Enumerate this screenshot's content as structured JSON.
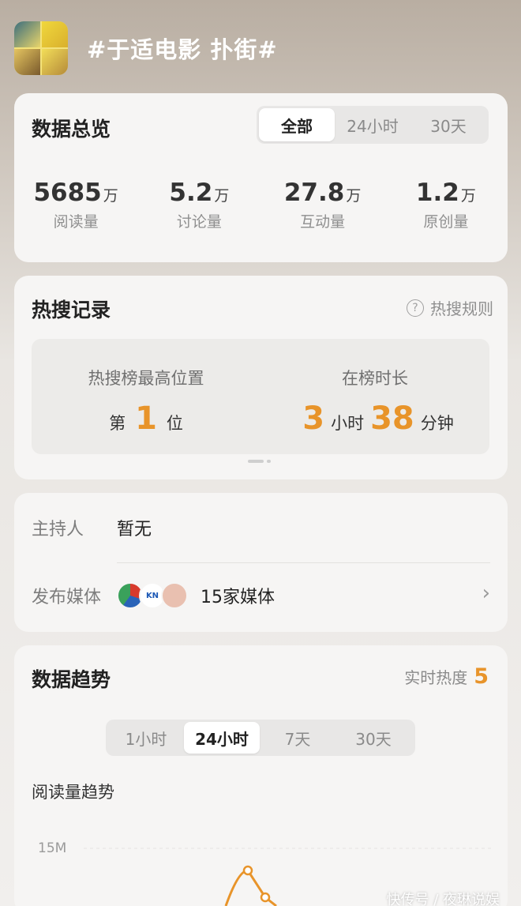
{
  "header": {
    "title": "#于适电影 扑街#",
    "avatar": "topic-avatar-collage"
  },
  "overview": {
    "title": "数据总览",
    "tabs": [
      {
        "label": "全部",
        "active": true
      },
      {
        "label": "24小时",
        "active": false
      },
      {
        "label": "30天",
        "active": false
      }
    ],
    "stats": [
      {
        "value": "5685",
        "unit": "万",
        "label": "阅读量"
      },
      {
        "value": "5.2",
        "unit": "万",
        "label": "讨论量"
      },
      {
        "value": "27.8",
        "unit": "万",
        "label": "互动量"
      },
      {
        "value": "1.2",
        "unit": "万",
        "label": "原创量"
      }
    ]
  },
  "hot": {
    "title": "热搜记录",
    "rules_label": "热搜规则",
    "rules_icon": "question-icon",
    "peak_label": "热搜榜最高位置",
    "peak_prefix": "第",
    "peak_value": "1",
    "peak_suffix": "位",
    "duration_label": "在榜时长",
    "hours_value": "3",
    "hours_unit": "小时",
    "minutes_value": "38",
    "minutes_unit": "分钟"
  },
  "info": {
    "host_label": "主持人",
    "host_value": "暂无",
    "media_label": "发布媒体",
    "media_value": "15家媒体",
    "media_logo_text": "KN"
  },
  "trend": {
    "title": "数据趋势",
    "heat_label": "实时热度",
    "heat_value": "5",
    "tabs": [
      {
        "label": "1小时",
        "active": false
      },
      {
        "label": "24小时",
        "active": true
      },
      {
        "label": "7天",
        "active": false
      },
      {
        "label": "30天",
        "active": false
      }
    ],
    "subtitle": "阅读量趋势"
  },
  "colors": {
    "accent": "#e8942a",
    "card": "#f6f5f4"
  },
  "chart_data": {
    "type": "line",
    "title": "阅读量趋势",
    "y_ticks": [
      "15M"
    ],
    "series": [
      {
        "values": [
          15,
          14
        ]
      }
    ]
  },
  "watermark": "快传号 / 夜琳说娱"
}
